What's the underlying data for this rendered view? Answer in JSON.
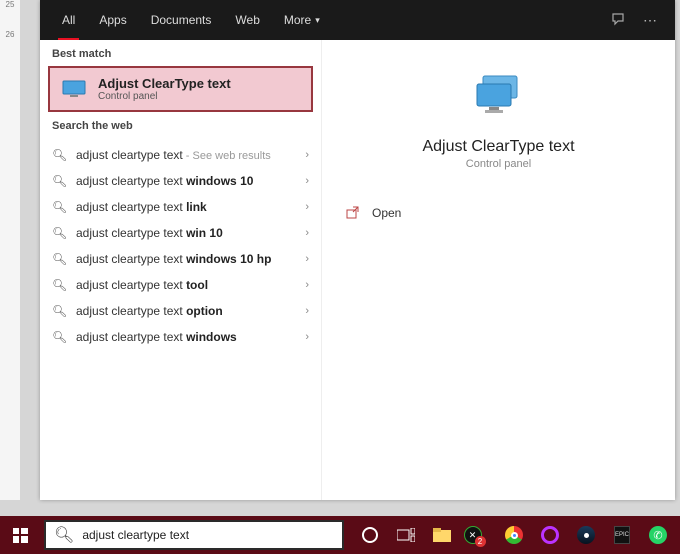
{
  "ruler": {
    "tick1": "25",
    "tick2": "26"
  },
  "header": {
    "tabs": {
      "all": "All",
      "apps": "Apps",
      "documents": "Documents",
      "web": "Web",
      "more": "More"
    }
  },
  "labels": {
    "best_match": "Best match",
    "search_web": "Search the web"
  },
  "best_match": {
    "title": "Adjust ClearType text",
    "sub": "Control panel"
  },
  "web": [
    {
      "base": "adjust cleartype text",
      "bold": "",
      "hint": " - See web results"
    },
    {
      "base": "adjust cleartype text ",
      "bold": "windows 10",
      "hint": ""
    },
    {
      "base": "adjust cleartype text ",
      "bold": "link",
      "hint": ""
    },
    {
      "base": "adjust cleartype text ",
      "bold": "win 10",
      "hint": ""
    },
    {
      "base": "adjust cleartype text ",
      "bold": "windows 10 hp",
      "hint": ""
    },
    {
      "base": "adjust cleartype text ",
      "bold": "tool",
      "hint": ""
    },
    {
      "base": "adjust cleartype text ",
      "bold": "option",
      "hint": ""
    },
    {
      "base": "adjust cleartype text ",
      "bold": "windows",
      "hint": ""
    }
  ],
  "preview": {
    "title": "Adjust ClearType text",
    "sub": "Control panel",
    "open": "Open"
  },
  "search": {
    "value": "adjust cleartype text"
  }
}
